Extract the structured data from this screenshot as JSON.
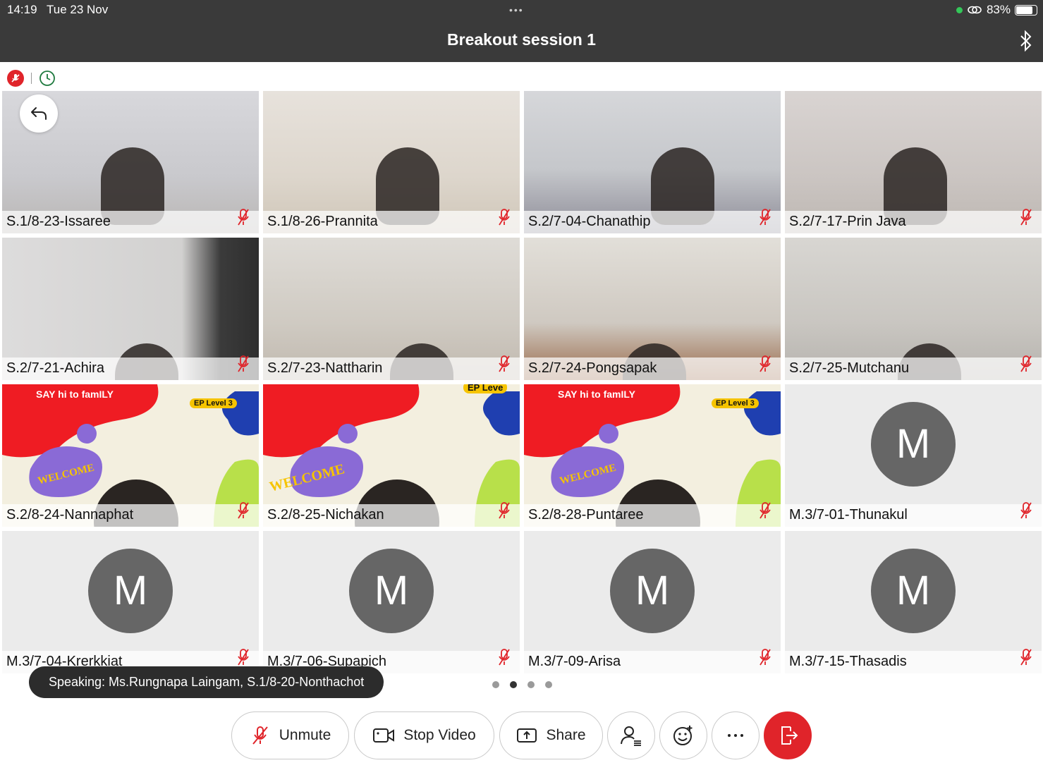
{
  "status": {
    "time": "14:19",
    "date": "Tue 23 Nov",
    "battery": "83%",
    "battery_level": 0.83
  },
  "header": {
    "title": "Breakout session 1"
  },
  "participants": [
    {
      "name": "S.1/8-23-Issaree",
      "kind": "video"
    },
    {
      "name": "S.1/8-26-Prannita",
      "kind": "video"
    },
    {
      "name": "S.2/7-04-Chanathip",
      "kind": "video"
    },
    {
      "name": "S.2/7-17-Prin Java",
      "kind": "video"
    },
    {
      "name": "S.2/7-21-Achira",
      "kind": "video"
    },
    {
      "name": "S.2/7-23-Nattharin",
      "kind": "video"
    },
    {
      "name": "S.2/7-24-Pongsapak",
      "kind": "video"
    },
    {
      "name": "S.2/7-25-Mutchanu",
      "kind": "video"
    },
    {
      "name": "S.2/8-24-Nannaphat",
      "kind": "background",
      "banner": "SAY hi to famILY",
      "badge": "EP Level 3",
      "sign": "WELCOME"
    },
    {
      "name": "S.2/8-25-Nichakan",
      "kind": "background",
      "banner": "",
      "badge": "EP Leve",
      "sign": "WELCOME"
    },
    {
      "name": "S.2/8-28-Puntaree",
      "kind": "background",
      "banner": "SAY hi to famILY",
      "badge": "EP Level 3",
      "sign": "WELCOME"
    },
    {
      "name": "M.3/7-01-Thunakul",
      "kind": "avatar",
      "initial": "M"
    },
    {
      "name": "M.3/7-04-Krerkkiat",
      "kind": "avatar",
      "initial": "M"
    },
    {
      "name": "M.3/7-06-Supapich",
      "kind": "avatar",
      "initial": "M"
    },
    {
      "name": "M.3/7-09-Arisa",
      "kind": "avatar",
      "initial": "M"
    },
    {
      "name": "M.3/7-15-Thasadis",
      "kind": "avatar",
      "initial": "M"
    }
  ],
  "speaking": "Speaking: Ms.Rungnapa Laingam, S.1/8-20-Nonthachot",
  "pager": {
    "pages": 4,
    "current": 2
  },
  "toolbar": {
    "unmute": "Unmute",
    "stop_video": "Stop Video",
    "share": "Share"
  },
  "colors": {
    "accent_red": "#e0242a",
    "bar_dark": "#3a3a3a",
    "avatar_gray": "#666666"
  }
}
